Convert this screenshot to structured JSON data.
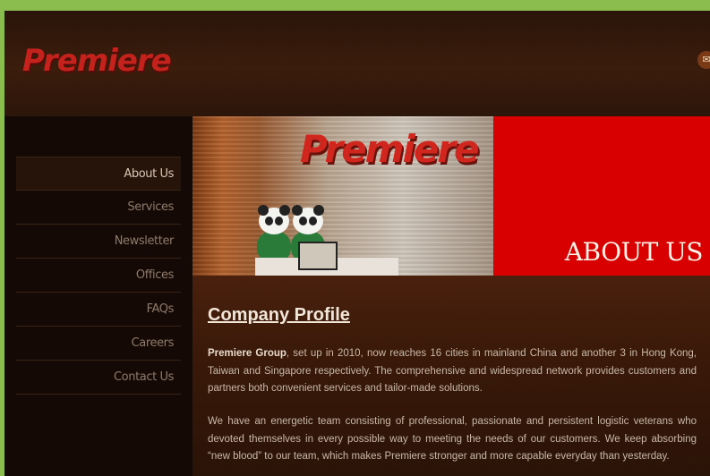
{
  "header": {
    "logo_text": "Premiere",
    "mail_icon": "mail-icon"
  },
  "nav": {
    "items": [
      {
        "label": "About Us",
        "active": true
      },
      {
        "label": "Services"
      },
      {
        "label": "Newsletter"
      },
      {
        "label": "Offices"
      },
      {
        "label": "FAQs"
      },
      {
        "label": "Careers"
      },
      {
        "label": "Contact Us"
      }
    ]
  },
  "banner": {
    "logo_text": "Premiere",
    "heading": "ABOUT US",
    "accent_color": "#d80000"
  },
  "content": {
    "title": "Company Profile",
    "p1_company": "Premiere Group",
    "p1_text": ", set up in 2010, now reaches 16 cities in mainland China and another 3 in Hong Kong, Taiwan and Singapore respectively. The comprehensive and widespread network provides customers and partners both convenient services and tailor-made solutions.",
    "p2_text": "We have an energetic team consisting of professional, passionate and persistent logistic veterans who devoted themselves in every possible way to meeting the needs of our customers. We keep absorbing “new blood” to our team, which makes Premiere stronger and more capable everyday than yesterday."
  }
}
